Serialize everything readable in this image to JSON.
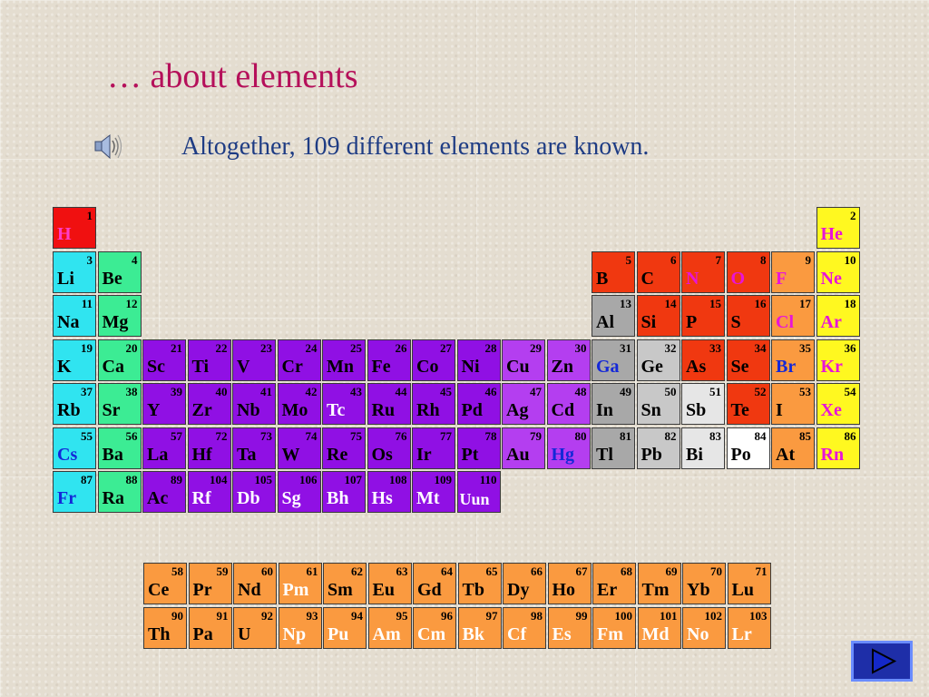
{
  "slide": {
    "title": "… about elements",
    "subtitle": "Altogether, 109 different elements are known."
  },
  "icons": {
    "audio": "speaker-icon",
    "next": "next-arrow-icon"
  },
  "colors": {
    "title": "#b5105a",
    "subtitle": "#1e3c84",
    "white_symbol": "#ffffff",
    "blue_symbol": "#1428d8",
    "pink_symbol": "#ff3cc8",
    "magenta_symbol": "#e814d8",
    "nav_button": "#1e2ea8"
  },
  "periodic_table": {
    "main": [
      {
        "n": "1",
        "s": "H",
        "r": 0,
        "c": 0,
        "bg": "#f01010",
        "fg": "#ff3cc8"
      },
      {
        "n": "2",
        "s": "He",
        "r": 0,
        "c": 17,
        "bg": "#fff820",
        "fg": "#e814d8"
      },
      {
        "n": "3",
        "s": "Li",
        "r": 1,
        "c": 0,
        "bg": "#30e4f0"
      },
      {
        "n": "4",
        "s": "Be",
        "r": 1,
        "c": 1,
        "bg": "#3cec94"
      },
      {
        "n": "5",
        "s": "B",
        "r": 1,
        "c": 12,
        "bg": "#f03810"
      },
      {
        "n": "6",
        "s": "C",
        "r": 1,
        "c": 13,
        "bg": "#f03810"
      },
      {
        "n": "7",
        "s": "N",
        "r": 1,
        "c": 14,
        "bg": "#f03810",
        "fg": "#e814d8"
      },
      {
        "n": "8",
        "s": "O",
        "r": 1,
        "c": 15,
        "bg": "#f03810",
        "fg": "#e814d8"
      },
      {
        "n": "9",
        "s": "F",
        "r": 1,
        "c": 16,
        "bg": "#fa9a40",
        "fg": "#e814d8"
      },
      {
        "n": "10",
        "s": "Ne",
        "r": 1,
        "c": 17,
        "bg": "#fff820",
        "fg": "#e814d8"
      },
      {
        "n": "11",
        "s": "Na",
        "r": 2,
        "c": 0,
        "bg": "#30e4f0"
      },
      {
        "n": "12",
        "s": "Mg",
        "r": 2,
        "c": 1,
        "bg": "#3cec94"
      },
      {
        "n": "13",
        "s": "Al",
        "r": 2,
        "c": 12,
        "bg": "#a8a8a8"
      },
      {
        "n": "14",
        "s": "Si",
        "r": 2,
        "c": 13,
        "bg": "#f03810"
      },
      {
        "n": "15",
        "s": "P",
        "r": 2,
        "c": 14,
        "bg": "#f03810"
      },
      {
        "n": "16",
        "s": "S",
        "r": 2,
        "c": 15,
        "bg": "#f03810"
      },
      {
        "n": "17",
        "s": "Cl",
        "r": 2,
        "c": 16,
        "bg": "#fa9a40",
        "fg": "#e814d8"
      },
      {
        "n": "18",
        "s": "Ar",
        "r": 2,
        "c": 17,
        "bg": "#fff820",
        "fg": "#e814d8"
      },
      {
        "n": "19",
        "s": "K",
        "r": 3,
        "c": 0,
        "bg": "#30e4f0"
      },
      {
        "n": "20",
        "s": "Ca",
        "r": 3,
        "c": 1,
        "bg": "#3cec94"
      },
      {
        "n": "21",
        "s": "Sc",
        "r": 3,
        "c": 2,
        "bg": "#9010e4"
      },
      {
        "n": "22",
        "s": "Ti",
        "r": 3,
        "c": 3,
        "bg": "#9010e4"
      },
      {
        "n": "23",
        "s": "V",
        "r": 3,
        "c": 4,
        "bg": "#9010e4"
      },
      {
        "n": "24",
        "s": "Cr",
        "r": 3,
        "c": 5,
        "bg": "#9010e4"
      },
      {
        "n": "25",
        "s": "Mn",
        "r": 3,
        "c": 6,
        "bg": "#9010e4"
      },
      {
        "n": "26",
        "s": "Fe",
        "r": 3,
        "c": 7,
        "bg": "#9010e4"
      },
      {
        "n": "27",
        "s": "Co",
        "r": 3,
        "c": 8,
        "bg": "#9010e4"
      },
      {
        "n": "28",
        "s": "Ni",
        "r": 3,
        "c": 9,
        "bg": "#9010e4"
      },
      {
        "n": "29",
        "s": "Cu",
        "r": 3,
        "c": 10,
        "bg": "#b43ef0"
      },
      {
        "n": "30",
        "s": "Zn",
        "r": 3,
        "c": 11,
        "bg": "#b43ef0"
      },
      {
        "n": "31",
        "s": "Ga",
        "r": 3,
        "c": 12,
        "bg": "#a8a8a8",
        "fg": "#1428d8"
      },
      {
        "n": "32",
        "s": "Ge",
        "r": 3,
        "c": 13,
        "bg": "#c8c8c8"
      },
      {
        "n": "33",
        "s": "As",
        "r": 3,
        "c": 14,
        "bg": "#f03810"
      },
      {
        "n": "34",
        "s": "Se",
        "r": 3,
        "c": 15,
        "bg": "#f03810"
      },
      {
        "n": "35",
        "s": "Br",
        "r": 3,
        "c": 16,
        "bg": "#fa9a40",
        "fg": "#1428d8"
      },
      {
        "n": "36",
        "s": "Kr",
        "r": 3,
        "c": 17,
        "bg": "#fff820",
        "fg": "#e814d8"
      },
      {
        "n": "37",
        "s": "Rb",
        "r": 4,
        "c": 0,
        "bg": "#30e4f0"
      },
      {
        "n": "38",
        "s": "Sr",
        "r": 4,
        "c": 1,
        "bg": "#3cec94"
      },
      {
        "n": "39",
        "s": "Y",
        "r": 4,
        "c": 2,
        "bg": "#9010e4"
      },
      {
        "n": "40",
        "s": "Zr",
        "r": 4,
        "c": 3,
        "bg": "#9010e4"
      },
      {
        "n": "41",
        "s": "Nb",
        "r": 4,
        "c": 4,
        "bg": "#9010e4"
      },
      {
        "n": "42",
        "s": "Mo",
        "r": 4,
        "c": 5,
        "bg": "#9010e4"
      },
      {
        "n": "43",
        "s": "Tc",
        "r": 4,
        "c": 6,
        "bg": "#9010e4",
        "fg": "#ffffff"
      },
      {
        "n": "44",
        "s": "Ru",
        "r": 4,
        "c": 7,
        "bg": "#9010e4"
      },
      {
        "n": "45",
        "s": "Rh",
        "r": 4,
        "c": 8,
        "bg": "#9010e4"
      },
      {
        "n": "46",
        "s": "Pd",
        "r": 4,
        "c": 9,
        "bg": "#9010e4"
      },
      {
        "n": "47",
        "s": "Ag",
        "r": 4,
        "c": 10,
        "bg": "#b43ef0"
      },
      {
        "n": "48",
        "s": "Cd",
        "r": 4,
        "c": 11,
        "bg": "#b43ef0"
      },
      {
        "n": "49",
        "s": "In",
        "r": 4,
        "c": 12,
        "bg": "#a8a8a8"
      },
      {
        "n": "50",
        "s": "Sn",
        "r": 4,
        "c": 13,
        "bg": "#c8c8c8"
      },
      {
        "n": "51",
        "s": "Sb",
        "r": 4,
        "c": 14,
        "bg": "#e6e6e6"
      },
      {
        "n": "52",
        "s": "Te",
        "r": 4,
        "c": 15,
        "bg": "#f03810"
      },
      {
        "n": "53",
        "s": "I",
        "r": 4,
        "c": 16,
        "bg": "#fa9a40"
      },
      {
        "n": "54",
        "s": "Xe",
        "r": 4,
        "c": 17,
        "bg": "#fff820",
        "fg": "#e814d8"
      },
      {
        "n": "55",
        "s": "Cs",
        "r": 5,
        "c": 0,
        "bg": "#30e4f0",
        "fg": "#1428d8"
      },
      {
        "n": "56",
        "s": "Ba",
        "r": 5,
        "c": 1,
        "bg": "#3cec94"
      },
      {
        "n": "57",
        "s": "La",
        "r": 5,
        "c": 2,
        "bg": "#9010e4"
      },
      {
        "n": "72",
        "s": "Hf",
        "r": 5,
        "c": 3,
        "bg": "#9010e4"
      },
      {
        "n": "73",
        "s": "Ta",
        "r": 5,
        "c": 4,
        "bg": "#9010e4"
      },
      {
        "n": "74",
        "s": "W",
        "r": 5,
        "c": 5,
        "bg": "#9010e4"
      },
      {
        "n": "75",
        "s": "Re",
        "r": 5,
        "c": 6,
        "bg": "#9010e4"
      },
      {
        "n": "76",
        "s": "Os",
        "r": 5,
        "c": 7,
        "bg": "#9010e4"
      },
      {
        "n": "77",
        "s": "Ir",
        "r": 5,
        "c": 8,
        "bg": "#9010e4"
      },
      {
        "n": "78",
        "s": "Pt",
        "r": 5,
        "c": 9,
        "bg": "#9010e4"
      },
      {
        "n": "79",
        "s": "Au",
        "r": 5,
        "c": 10,
        "bg": "#b43ef0"
      },
      {
        "n": "80",
        "s": "Hg",
        "r": 5,
        "c": 11,
        "bg": "#b43ef0",
        "fg": "#1428d8"
      },
      {
        "n": "81",
        "s": "Tl",
        "r": 5,
        "c": 12,
        "bg": "#a8a8a8"
      },
      {
        "n": "82",
        "s": "Pb",
        "r": 5,
        "c": 13,
        "bg": "#c8c8c8"
      },
      {
        "n": "83",
        "s": "Bi",
        "r": 5,
        "c": 14,
        "bg": "#e6e6e6"
      },
      {
        "n": "84",
        "s": "Po",
        "r": 5,
        "c": 15,
        "bg": "#ffffff"
      },
      {
        "n": "85",
        "s": "At",
        "r": 5,
        "c": 16,
        "bg": "#fa9a40"
      },
      {
        "n": "86",
        "s": "Rn",
        "r": 5,
        "c": 17,
        "bg": "#fff820",
        "fg": "#e814d8"
      },
      {
        "n": "87",
        "s": "Fr",
        "r": 6,
        "c": 0,
        "bg": "#30e4f0",
        "fg": "#1428d8"
      },
      {
        "n": "88",
        "s": "Ra",
        "r": 6,
        "c": 1,
        "bg": "#3cec94"
      },
      {
        "n": "89",
        "s": "Ac",
        "r": 6,
        "c": 2,
        "bg": "#9010e4"
      },
      {
        "n": "104",
        "s": "Rf",
        "r": 6,
        "c": 3,
        "bg": "#9010e4",
        "fg": "#ffffff"
      },
      {
        "n": "105",
        "s": "Db",
        "r": 6,
        "c": 4,
        "bg": "#9010e4",
        "fg": "#ffffff"
      },
      {
        "n": "106",
        "s": "Sg",
        "r": 6,
        "c": 5,
        "bg": "#9010e4",
        "fg": "#ffffff"
      },
      {
        "n": "107",
        "s": "Bh",
        "r": 6,
        "c": 6,
        "bg": "#9010e4",
        "fg": "#ffffff"
      },
      {
        "n": "108",
        "s": "Hs",
        "r": 6,
        "c": 7,
        "bg": "#9010e4",
        "fg": "#ffffff"
      },
      {
        "n": "109",
        "s": "Mt",
        "r": 6,
        "c": 8,
        "bg": "#9010e4",
        "fg": "#ffffff"
      },
      {
        "n": "110",
        "s": "Uun",
        "r": 6,
        "c": 9,
        "bg": "#9010e4",
        "fg": "#ffffff"
      }
    ],
    "f_block": [
      {
        "n": "58",
        "s": "Ce",
        "r": 0,
        "c": 0,
        "bg": "#fa9a40"
      },
      {
        "n": "59",
        "s": "Pr",
        "r": 0,
        "c": 1,
        "bg": "#fa9a40"
      },
      {
        "n": "60",
        "s": "Nd",
        "r": 0,
        "c": 2,
        "bg": "#fa9a40"
      },
      {
        "n": "61",
        "s": "Pm",
        "r": 0,
        "c": 3,
        "bg": "#fa9a40",
        "fg": "#ffffff"
      },
      {
        "n": "62",
        "s": "Sm",
        "r": 0,
        "c": 4,
        "bg": "#fa9a40"
      },
      {
        "n": "63",
        "s": "Eu",
        "r": 0,
        "c": 5,
        "bg": "#fa9a40"
      },
      {
        "n": "64",
        "s": "Gd",
        "r": 0,
        "c": 6,
        "bg": "#fa9a40"
      },
      {
        "n": "65",
        "s": "Tb",
        "r": 0,
        "c": 7,
        "bg": "#fa9a40"
      },
      {
        "n": "66",
        "s": "Dy",
        "r": 0,
        "c": 8,
        "bg": "#fa9a40"
      },
      {
        "n": "67",
        "s": "Ho",
        "r": 0,
        "c": 9,
        "bg": "#fa9a40"
      },
      {
        "n": "68",
        "s": "Er",
        "r": 0,
        "c": 10,
        "bg": "#fa9a40"
      },
      {
        "n": "69",
        "s": "Tm",
        "r": 0,
        "c": 11,
        "bg": "#fa9a40"
      },
      {
        "n": "70",
        "s": "Yb",
        "r": 0,
        "c": 12,
        "bg": "#fa9a40"
      },
      {
        "n": "71",
        "s": "Lu",
        "r": 0,
        "c": 13,
        "bg": "#fa9a40"
      },
      {
        "n": "90",
        "s": "Th",
        "r": 1,
        "c": 0,
        "bg": "#fa9a40"
      },
      {
        "n": "91",
        "s": "Pa",
        "r": 1,
        "c": 1,
        "bg": "#fa9a40"
      },
      {
        "n": "92",
        "s": "U",
        "r": 1,
        "c": 2,
        "bg": "#fa9a40"
      },
      {
        "n": "93",
        "s": "Np",
        "r": 1,
        "c": 3,
        "bg": "#fa9a40",
        "fg": "#ffffff"
      },
      {
        "n": "94",
        "s": "Pu",
        "r": 1,
        "c": 4,
        "bg": "#fa9a40",
        "fg": "#ffffff"
      },
      {
        "n": "95",
        "s": "Am",
        "r": 1,
        "c": 5,
        "bg": "#fa9a40",
        "fg": "#ffffff"
      },
      {
        "n": "96",
        "s": "Cm",
        "r": 1,
        "c": 6,
        "bg": "#fa9a40",
        "fg": "#ffffff"
      },
      {
        "n": "97",
        "s": "Bk",
        "r": 1,
        "c": 7,
        "bg": "#fa9a40",
        "fg": "#ffffff"
      },
      {
        "n": "98",
        "s": "Cf",
        "r": 1,
        "c": 8,
        "bg": "#fa9a40",
        "fg": "#ffffff"
      },
      {
        "n": "99",
        "s": "Es",
        "r": 1,
        "c": 9,
        "bg": "#fa9a40",
        "fg": "#ffffff"
      },
      {
        "n": "100",
        "s": "Fm",
        "r": 1,
        "c": 10,
        "bg": "#fa9a40",
        "fg": "#ffffff"
      },
      {
        "n": "101",
        "s": "Md",
        "r": 1,
        "c": 11,
        "bg": "#fa9a40",
        "fg": "#ffffff"
      },
      {
        "n": "102",
        "s": "No",
        "r": 1,
        "c": 12,
        "bg": "#fa9a40",
        "fg": "#ffffff"
      },
      {
        "n": "103",
        "s": "Lr",
        "r": 1,
        "c": 13,
        "bg": "#fa9a40",
        "fg": "#ffffff"
      }
    ]
  }
}
